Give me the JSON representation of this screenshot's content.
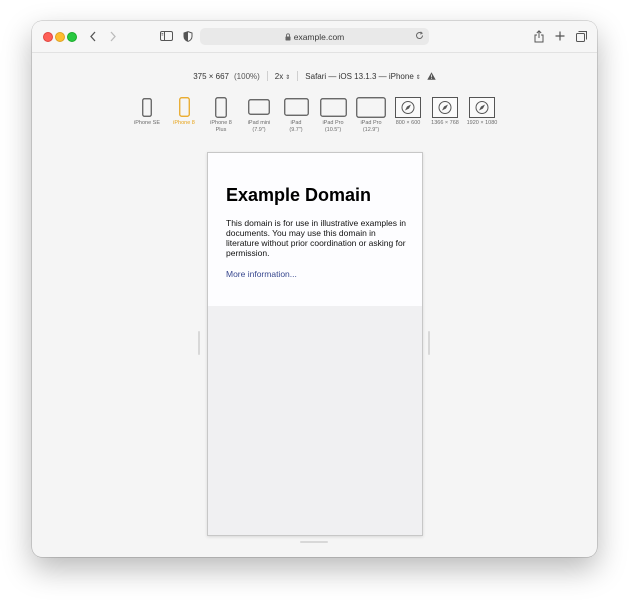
{
  "browser": {
    "url": "example.com"
  },
  "responsive_toolbar": {
    "dimensions": "375 × 667",
    "zoom_percent": "(100%)",
    "scale": "2x",
    "user_agent": "Safari — iOS 13.1.3 — iPhone"
  },
  "devices": [
    {
      "label": "iPhone SE",
      "icon": "iphone-se-icon",
      "selected": false
    },
    {
      "label": "iPhone 8",
      "icon": "iphone-8-icon",
      "selected": true
    },
    {
      "label": "iPhone 8\nPlus",
      "icon": "iphone-8-plus-icon",
      "selected": false
    },
    {
      "label": "iPad mini\n(7.9\")",
      "icon": "ipad-mini-icon",
      "selected": false
    },
    {
      "label": "iPad\n(9.7\")",
      "icon": "ipad-icon",
      "selected": false
    },
    {
      "label": "iPad Pro\n(10.5\")",
      "icon": "ipad-pro-105-icon",
      "selected": false
    },
    {
      "label": "iPad Pro\n(12.9\")",
      "icon": "ipad-pro-129-icon",
      "selected": false
    },
    {
      "label": "800 × 600",
      "icon": "safari-window-icon",
      "selected": false
    },
    {
      "label": "1366 × 768",
      "icon": "safari-window-icon",
      "selected": false
    },
    {
      "label": "1920 × 1080",
      "icon": "safari-window-icon",
      "selected": false
    }
  ],
  "page": {
    "heading": "Example Domain",
    "body": "This domain is for use in illustrative examples in documents. You may use this domain in literature without prior coordination or asking for permission.",
    "link": "More information..."
  },
  "colors": {
    "selected_device": "#e8a317",
    "link": "#38488f",
    "traffic_red": "#fe5f57",
    "traffic_yellow": "#febc2e",
    "traffic_green": "#28c840"
  }
}
